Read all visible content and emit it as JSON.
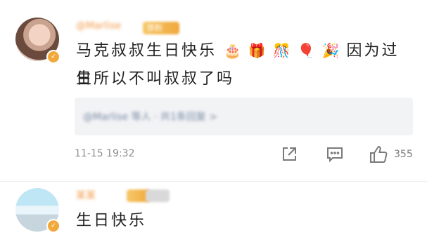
{
  "comments": [
    {
      "username": "@Marlise",
      "badge": "铁粉",
      "text_line1": "马克叔叔生日快乐",
      "emojis": [
        "🎂",
        "🎁",
        "🎊",
        "🎈",
        "🎉"
      ],
      "text_after_emoji": "因为过生",
      "text_line2": "日所以不叫叔叔了吗",
      "reply_preview": "@Marlise 等人 · 共1条回复 >",
      "timestamp": "11-15 19:32",
      "like_count": "355"
    },
    {
      "username": "某某",
      "text": "生日快乐"
    }
  ],
  "colors": {
    "accent": "#f39a4a",
    "muted": "#8e8e8e",
    "reply_bg": "#f2f3f5"
  },
  "icons": [
    "share-icon",
    "comment-icon",
    "like-icon"
  ]
}
